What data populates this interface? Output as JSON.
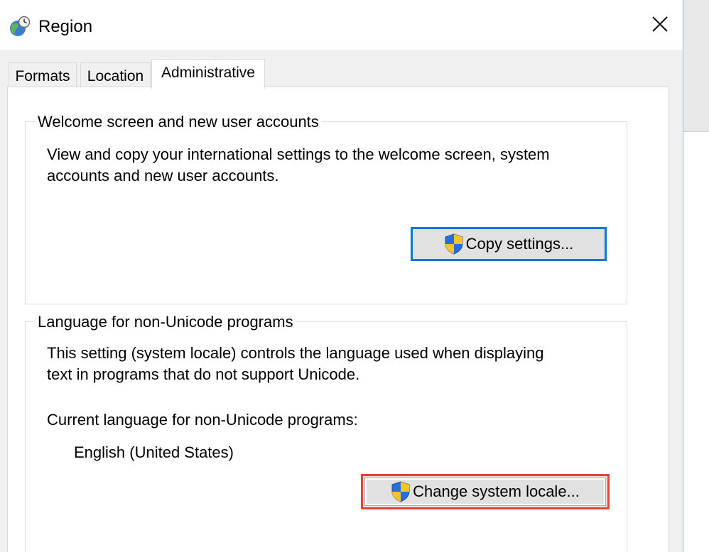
{
  "window": {
    "title": "Region",
    "title_icon": "globe-clock-icon",
    "close_icon": "close-icon"
  },
  "tabs": [
    {
      "label": "Formats",
      "active": false
    },
    {
      "label": "Location",
      "active": false
    },
    {
      "label": "Administrative",
      "active": true
    }
  ],
  "welcome_group": {
    "legend": "Welcome screen and new user accounts",
    "description_line1": "View and copy your international settings to the welcome screen, system",
    "description_line2": "accounts and new user accounts.",
    "copy_button_label": "Copy settings...",
    "button_icon": "uac-shield-icon"
  },
  "locale_group": {
    "legend": "Language for non-Unicode programs",
    "description_line1": "This setting (system locale) controls the language used when displaying",
    "description_line2": "text in programs that do not support Unicode.",
    "current_label": "Current language for non-Unicode programs:",
    "current_value": "English (United States)",
    "change_button_label": "Change system locale...",
    "button_icon": "uac-shield-icon"
  },
  "colors": {
    "focus_blue": "#0078d7",
    "highlight_red": "#e0443a",
    "dialog_bg": "#f0f0f0",
    "button_bg": "#e1e1e1"
  }
}
